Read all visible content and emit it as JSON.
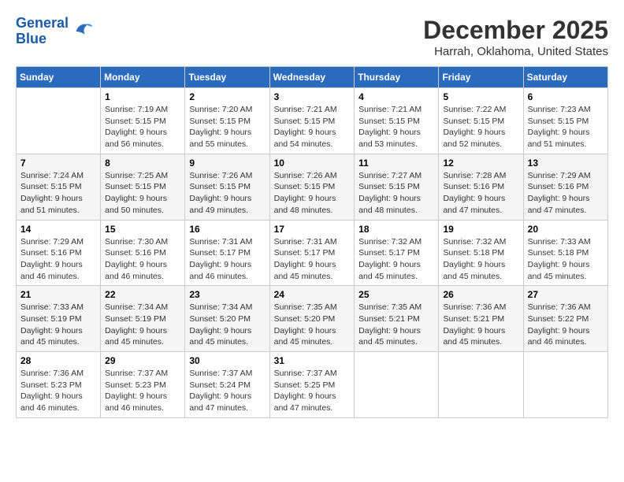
{
  "header": {
    "logo_line1": "General",
    "logo_line2": "Blue",
    "month": "December 2025",
    "location": "Harrah, Oklahoma, United States"
  },
  "weekdays": [
    "Sunday",
    "Monday",
    "Tuesday",
    "Wednesday",
    "Thursday",
    "Friday",
    "Saturday"
  ],
  "weeks": [
    [
      {
        "day": "",
        "info": ""
      },
      {
        "day": "1",
        "info": "Sunrise: 7:19 AM\nSunset: 5:15 PM\nDaylight: 9 hours\nand 56 minutes."
      },
      {
        "day": "2",
        "info": "Sunrise: 7:20 AM\nSunset: 5:15 PM\nDaylight: 9 hours\nand 55 minutes."
      },
      {
        "day": "3",
        "info": "Sunrise: 7:21 AM\nSunset: 5:15 PM\nDaylight: 9 hours\nand 54 minutes."
      },
      {
        "day": "4",
        "info": "Sunrise: 7:21 AM\nSunset: 5:15 PM\nDaylight: 9 hours\nand 53 minutes."
      },
      {
        "day": "5",
        "info": "Sunrise: 7:22 AM\nSunset: 5:15 PM\nDaylight: 9 hours\nand 52 minutes."
      },
      {
        "day": "6",
        "info": "Sunrise: 7:23 AM\nSunset: 5:15 PM\nDaylight: 9 hours\nand 51 minutes."
      }
    ],
    [
      {
        "day": "7",
        "info": "Sunrise: 7:24 AM\nSunset: 5:15 PM\nDaylight: 9 hours\nand 51 minutes."
      },
      {
        "day": "8",
        "info": "Sunrise: 7:25 AM\nSunset: 5:15 PM\nDaylight: 9 hours\nand 50 minutes."
      },
      {
        "day": "9",
        "info": "Sunrise: 7:26 AM\nSunset: 5:15 PM\nDaylight: 9 hours\nand 49 minutes."
      },
      {
        "day": "10",
        "info": "Sunrise: 7:26 AM\nSunset: 5:15 PM\nDaylight: 9 hours\nand 48 minutes."
      },
      {
        "day": "11",
        "info": "Sunrise: 7:27 AM\nSunset: 5:15 PM\nDaylight: 9 hours\nand 48 minutes."
      },
      {
        "day": "12",
        "info": "Sunrise: 7:28 AM\nSunset: 5:16 PM\nDaylight: 9 hours\nand 47 minutes."
      },
      {
        "day": "13",
        "info": "Sunrise: 7:29 AM\nSunset: 5:16 PM\nDaylight: 9 hours\nand 47 minutes."
      }
    ],
    [
      {
        "day": "14",
        "info": "Sunrise: 7:29 AM\nSunset: 5:16 PM\nDaylight: 9 hours\nand 46 minutes."
      },
      {
        "day": "15",
        "info": "Sunrise: 7:30 AM\nSunset: 5:16 PM\nDaylight: 9 hours\nand 46 minutes."
      },
      {
        "day": "16",
        "info": "Sunrise: 7:31 AM\nSunset: 5:17 PM\nDaylight: 9 hours\nand 46 minutes."
      },
      {
        "day": "17",
        "info": "Sunrise: 7:31 AM\nSunset: 5:17 PM\nDaylight: 9 hours\nand 45 minutes."
      },
      {
        "day": "18",
        "info": "Sunrise: 7:32 AM\nSunset: 5:17 PM\nDaylight: 9 hours\nand 45 minutes."
      },
      {
        "day": "19",
        "info": "Sunrise: 7:32 AM\nSunset: 5:18 PM\nDaylight: 9 hours\nand 45 minutes."
      },
      {
        "day": "20",
        "info": "Sunrise: 7:33 AM\nSunset: 5:18 PM\nDaylight: 9 hours\nand 45 minutes."
      }
    ],
    [
      {
        "day": "21",
        "info": "Sunrise: 7:33 AM\nSunset: 5:19 PM\nDaylight: 9 hours\nand 45 minutes."
      },
      {
        "day": "22",
        "info": "Sunrise: 7:34 AM\nSunset: 5:19 PM\nDaylight: 9 hours\nand 45 minutes."
      },
      {
        "day": "23",
        "info": "Sunrise: 7:34 AM\nSunset: 5:20 PM\nDaylight: 9 hours\nand 45 minutes."
      },
      {
        "day": "24",
        "info": "Sunrise: 7:35 AM\nSunset: 5:20 PM\nDaylight: 9 hours\nand 45 minutes."
      },
      {
        "day": "25",
        "info": "Sunrise: 7:35 AM\nSunset: 5:21 PM\nDaylight: 9 hours\nand 45 minutes."
      },
      {
        "day": "26",
        "info": "Sunrise: 7:36 AM\nSunset: 5:21 PM\nDaylight: 9 hours\nand 45 minutes."
      },
      {
        "day": "27",
        "info": "Sunrise: 7:36 AM\nSunset: 5:22 PM\nDaylight: 9 hours\nand 46 minutes."
      }
    ],
    [
      {
        "day": "28",
        "info": "Sunrise: 7:36 AM\nSunset: 5:23 PM\nDaylight: 9 hours\nand 46 minutes."
      },
      {
        "day": "29",
        "info": "Sunrise: 7:37 AM\nSunset: 5:23 PM\nDaylight: 9 hours\nand 46 minutes."
      },
      {
        "day": "30",
        "info": "Sunrise: 7:37 AM\nSunset: 5:24 PM\nDaylight: 9 hours\nand 47 minutes."
      },
      {
        "day": "31",
        "info": "Sunrise: 7:37 AM\nSunset: 5:25 PM\nDaylight: 9 hours\nand 47 minutes."
      },
      {
        "day": "",
        "info": ""
      },
      {
        "day": "",
        "info": ""
      },
      {
        "day": "",
        "info": ""
      }
    ]
  ]
}
